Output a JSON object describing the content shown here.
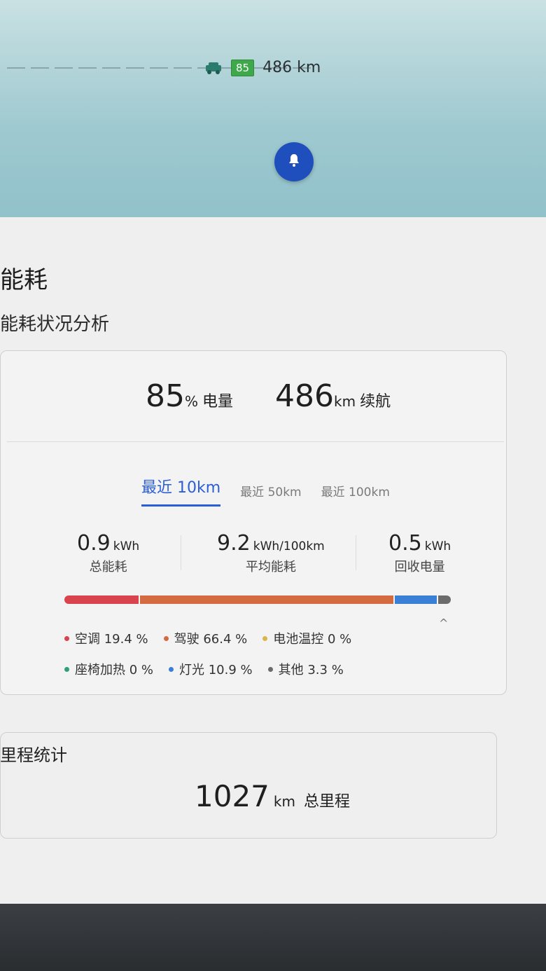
{
  "status_bar": {
    "battery_percent": "85",
    "range": "486 km",
    "icons": [
      "car-icon",
      "bell-icon"
    ]
  },
  "energy": {
    "title": "能耗",
    "subtitle": "能耗状况分析",
    "summary": {
      "battery_value": "85",
      "battery_unit": "%",
      "battery_caption": "电量",
      "range_value": "486",
      "range_unit": "km",
      "range_caption": "续航"
    },
    "tabs": [
      {
        "label": "最近 10km",
        "active": true
      },
      {
        "label": "最近 50km",
        "active": false
      },
      {
        "label": "最近 100km",
        "active": false
      }
    ],
    "metrics": [
      {
        "value": "0.9",
        "unit": "kWh",
        "label": "总能耗"
      },
      {
        "value": "9.2",
        "unit": "kWh/100km",
        "label": "平均能耗"
      },
      {
        "value": "0.5",
        "unit": "kWh",
        "label": "回收电量"
      }
    ],
    "breakdown": [
      {
        "label": "空调 19.4 %",
        "percent": 19.4,
        "color": "#d8434d"
      },
      {
        "label": "驾驶 66.4 %",
        "percent": 66.4,
        "color": "#d46a3f"
      },
      {
        "label": "电池温控 0 %",
        "percent": 0,
        "color": "#d8b64a"
      },
      {
        "label": "座椅加热 0 %",
        "percent": 0,
        "color": "#2e9f7a"
      },
      {
        "label": "灯光 10.9 %",
        "percent": 10.9,
        "color": "#3a7fd6"
      },
      {
        "label": "其他 3.3 %",
        "percent": 3.3,
        "color": "#6b6b6b"
      }
    ]
  },
  "mileage": {
    "title": "里程统计",
    "total_value": "1027",
    "total_unit": "km",
    "total_caption": "总里程"
  }
}
